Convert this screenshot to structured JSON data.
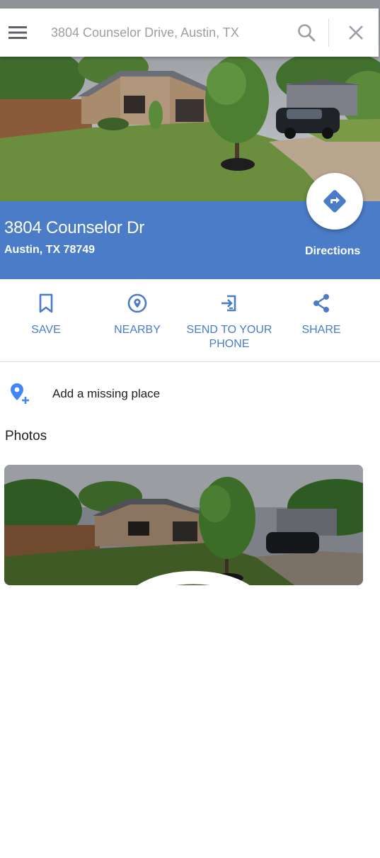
{
  "search": {
    "value": "3804 Counselor Drive, Austin, TX"
  },
  "place": {
    "title": "3804 Counselor Dr",
    "address": "Austin, TX 78749",
    "directions_label": "Directions"
  },
  "actions": [
    {
      "label": "SAVE",
      "icon": "bookmark-icon"
    },
    {
      "label": "NEARBY",
      "icon": "nearby-icon"
    },
    {
      "label": "SEND TO YOUR\nPHONE",
      "icon": "send-to-phone-icon"
    },
    {
      "label": "SHARE",
      "icon": "share-icon"
    }
  ],
  "add_place": {
    "label": "Add a missing place",
    "icon": "add-location-icon"
  },
  "photos": {
    "title": "Photos",
    "badge_icon": "360-view-icon"
  },
  "colors": {
    "brand_blue": "#4a7cc7",
    "icon_grey": "#5f6368",
    "accent_blue": "#4285f4"
  }
}
